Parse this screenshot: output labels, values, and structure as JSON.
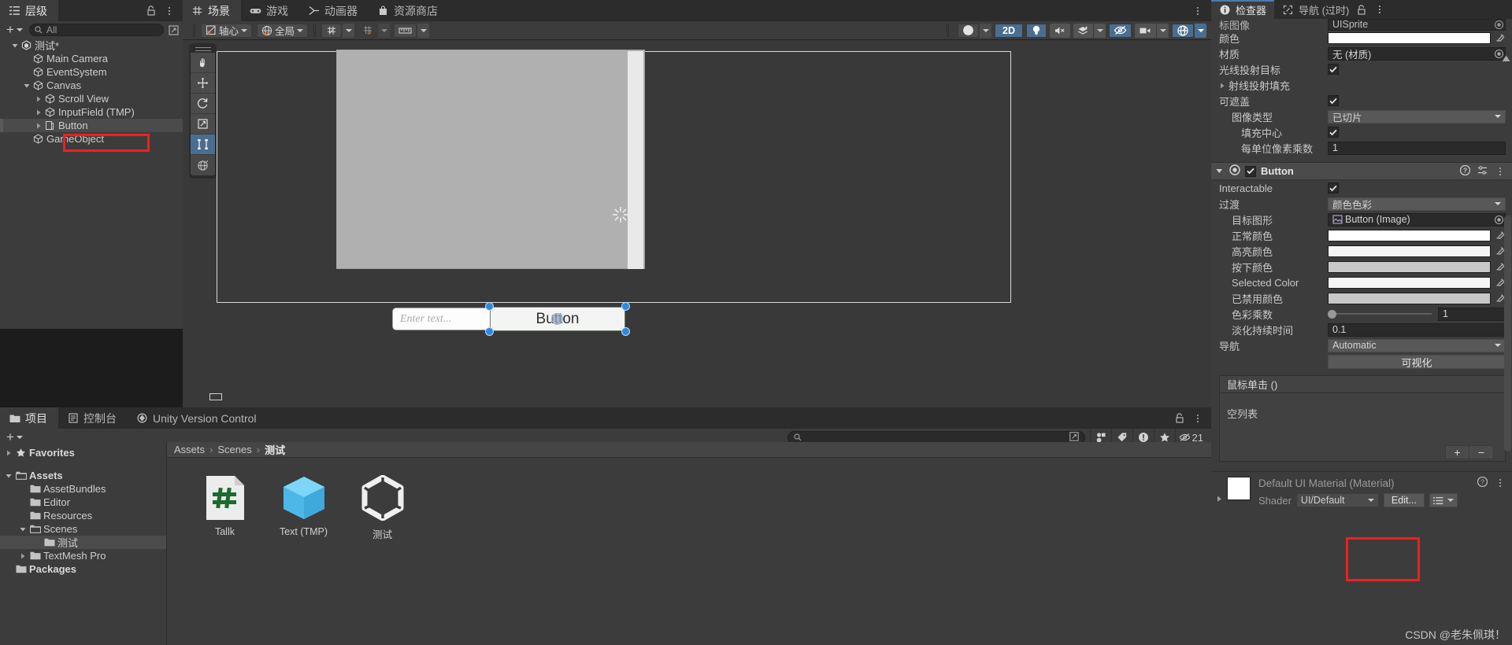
{
  "hierarchy": {
    "tab_label": "层级",
    "search_placeholder": "All",
    "items": [
      {
        "label": "测试*",
        "depth": 1,
        "icon": "unity-scene-icon",
        "expanded": true,
        "selected": false
      },
      {
        "label": "Main Camera",
        "depth": 2,
        "icon": "gameobject-icon",
        "expanded": null,
        "selected": false
      },
      {
        "label": "EventSystem",
        "depth": 2,
        "icon": "gameobject-icon",
        "expanded": null,
        "selected": false
      },
      {
        "label": "Canvas",
        "depth": 2,
        "icon": "gameobject-icon",
        "expanded": true,
        "selected": false
      },
      {
        "label": "Scroll View",
        "depth": 3,
        "icon": "gameobject-icon",
        "expanded": false,
        "selected": false
      },
      {
        "label": "InputField (TMP)",
        "depth": 3,
        "icon": "gameobject-icon",
        "expanded": false,
        "selected": false
      },
      {
        "label": "Button",
        "depth": 3,
        "icon": "ui-button-icon",
        "expanded": false,
        "selected": true
      },
      {
        "label": "GameObject",
        "depth": 2,
        "icon": "gameobject-icon",
        "expanded": null,
        "selected": false
      }
    ]
  },
  "scene": {
    "tabs": [
      {
        "label": "场景",
        "icon": "scene-grid-icon",
        "active": true
      },
      {
        "label": "游戏",
        "icon": "gamepad-icon",
        "active": false
      },
      {
        "label": "动画器",
        "icon": "animator-icon",
        "active": false
      },
      {
        "label": "资源商店",
        "icon": "asset-store-icon",
        "active": false
      }
    ],
    "toolbar": {
      "pivot_label": "轴心",
      "space_label": "全局",
      "grid_icon": "grid-snap-icon",
      "magnet_icon": "magnet-snap-icon",
      "ruler_icon": "ruler-icon",
      "shading_icon": "shading-mode-icon",
      "two_d_label": "2D",
      "light_icon": "lighting-icon",
      "audio_icon": "audio-mute-icon",
      "fx_icon": "effects-icon",
      "visibility_icon": "scene-visibility-icon",
      "camera_icon": "scene-camera-icon",
      "gizmos_icon": "gizmos-icon"
    },
    "tools": [
      {
        "name": "hand-tool",
        "active": false
      },
      {
        "name": "move-tool",
        "active": false
      },
      {
        "name": "rotate-tool",
        "active": false
      },
      {
        "name": "scale-tool",
        "active": false
      },
      {
        "name": "rect-tool",
        "active": true
      },
      {
        "name": "transform-tool",
        "active": false
      }
    ],
    "content": {
      "input_placeholder": "Enter text...",
      "button_label": "Button"
    }
  },
  "project": {
    "tabs": [
      {
        "label": "项目",
        "icon": "folder-icon",
        "active": true
      },
      {
        "label": "控制台",
        "icon": "console-icon",
        "active": false
      },
      {
        "label": "Unity Version Control",
        "icon": "unity-vcs-icon",
        "active": false
      }
    ],
    "search_placeholder": "",
    "hidden_count": "21",
    "tree": [
      {
        "label": "Favorites",
        "depth": 0,
        "icon": "star-icon",
        "expanded": false,
        "bold": true,
        "selected": false
      },
      {
        "label": "Assets",
        "depth": 0,
        "icon": "folder-open-icon",
        "expanded": true,
        "bold": true,
        "selected": false
      },
      {
        "label": "AssetBundles",
        "depth": 1,
        "icon": "folder-icon",
        "expanded": null,
        "bold": false,
        "selected": false
      },
      {
        "label": "Editor",
        "depth": 1,
        "icon": "folder-icon",
        "expanded": null,
        "bold": false,
        "selected": false
      },
      {
        "label": "Resources",
        "depth": 1,
        "icon": "folder-icon",
        "expanded": null,
        "bold": false,
        "selected": false
      },
      {
        "label": "Scenes",
        "depth": 1,
        "icon": "folder-open-icon",
        "expanded": true,
        "bold": false,
        "selected": false
      },
      {
        "label": "测试",
        "depth": 2,
        "icon": "folder-icon",
        "expanded": null,
        "bold": false,
        "selected": true
      },
      {
        "label": "TextMesh Pro",
        "depth": 1,
        "icon": "folder-icon",
        "expanded": false,
        "bold": false,
        "selected": false
      },
      {
        "label": "Packages",
        "depth": 0,
        "icon": "folder-icon",
        "expanded": null,
        "bold": true,
        "selected": false
      }
    ],
    "breadcrumb": [
      "Assets",
      "Scenes",
      "测试"
    ],
    "assets": [
      {
        "label": "Tallk",
        "icon": "csharp-script-icon"
      },
      {
        "label": "Text (TMP)",
        "icon": "prefab-icon"
      },
      {
        "label": "测试",
        "icon": "scene-asset-icon"
      }
    ]
  },
  "inspector": {
    "tabs": [
      {
        "label": "检查器",
        "icon": "info-icon",
        "active": true
      },
      {
        "label": "导航 (过时)",
        "icon": "navigation-icon",
        "active": false
      }
    ],
    "clipped_row": {
      "label": "标图像",
      "value": "UISprite"
    },
    "image_component": {
      "rows": [
        {
          "label": "颜色",
          "type": "color",
          "value": "#FFFFFF",
          "indent": 0
        },
        {
          "label": "材质",
          "type": "object",
          "value": "无 (材质)",
          "indent": 0
        },
        {
          "label": "光线投射目标",
          "type": "checkbox",
          "value": true,
          "indent": 0
        },
        {
          "label": "射线投射填充",
          "type": "foldout",
          "value": "",
          "indent": 0
        },
        {
          "label": "可遮盖",
          "type": "checkbox",
          "value": true,
          "indent": 0
        },
        {
          "label": "图像类型",
          "type": "dropdown",
          "value": "已切片",
          "indent": 1
        },
        {
          "label": "填充中心",
          "type": "checkbox",
          "value": true,
          "indent": 2
        },
        {
          "label": "每单位像素乘数",
          "type": "text",
          "value": "1",
          "indent": 2
        }
      ]
    },
    "button_component": {
      "title": "Button",
      "enabled": true,
      "rows": [
        {
          "label": "Interactable",
          "type": "checkbox",
          "value": true,
          "indent": 0
        },
        {
          "label": "过渡",
          "type": "dropdown",
          "value": "颜色色彩",
          "indent": 0
        },
        {
          "label": "目标图形",
          "type": "object",
          "value": "Button (Image)",
          "indent": 1
        },
        {
          "label": "正常颜色",
          "type": "color",
          "value": "#FFFFFF",
          "indent": 1
        },
        {
          "label": "高亮颜色",
          "type": "color",
          "value": "#F5F5F5",
          "indent": 1
        },
        {
          "label": "按下颜色",
          "type": "color",
          "value": "#C8C8C8",
          "indent": 1
        },
        {
          "label": "Selected Color",
          "type": "color",
          "value": "#F5F5F5",
          "indent": 1
        },
        {
          "label": "已禁用颜色",
          "type": "color",
          "value": "#C8C8C8",
          "indent": 1
        },
        {
          "label": "色彩乘数",
          "type": "slider",
          "value": "1",
          "indent": 1
        },
        {
          "label": "淡化持续时间",
          "type": "text",
          "value": "0.1",
          "indent": 1
        },
        {
          "label": "导航",
          "type": "dropdown",
          "value": "Automatic",
          "indent": 0
        }
      ],
      "visualize_label": "可视化",
      "event_title": "鼠标单击 ()",
      "event_empty": "空列表",
      "add_label": "+",
      "remove_label": "−"
    },
    "material": {
      "title": "Default UI Material (Material)",
      "shader_label": "Shader",
      "shader_value": "UI/Default",
      "edit_label": "Edit..."
    }
  },
  "watermark": "CSDN @老朱佩琪！",
  "colors": {
    "accent_blue": "#4a6e8f",
    "annotation_red": "#f01f1f",
    "panel_bg": "#3c3c3c"
  }
}
